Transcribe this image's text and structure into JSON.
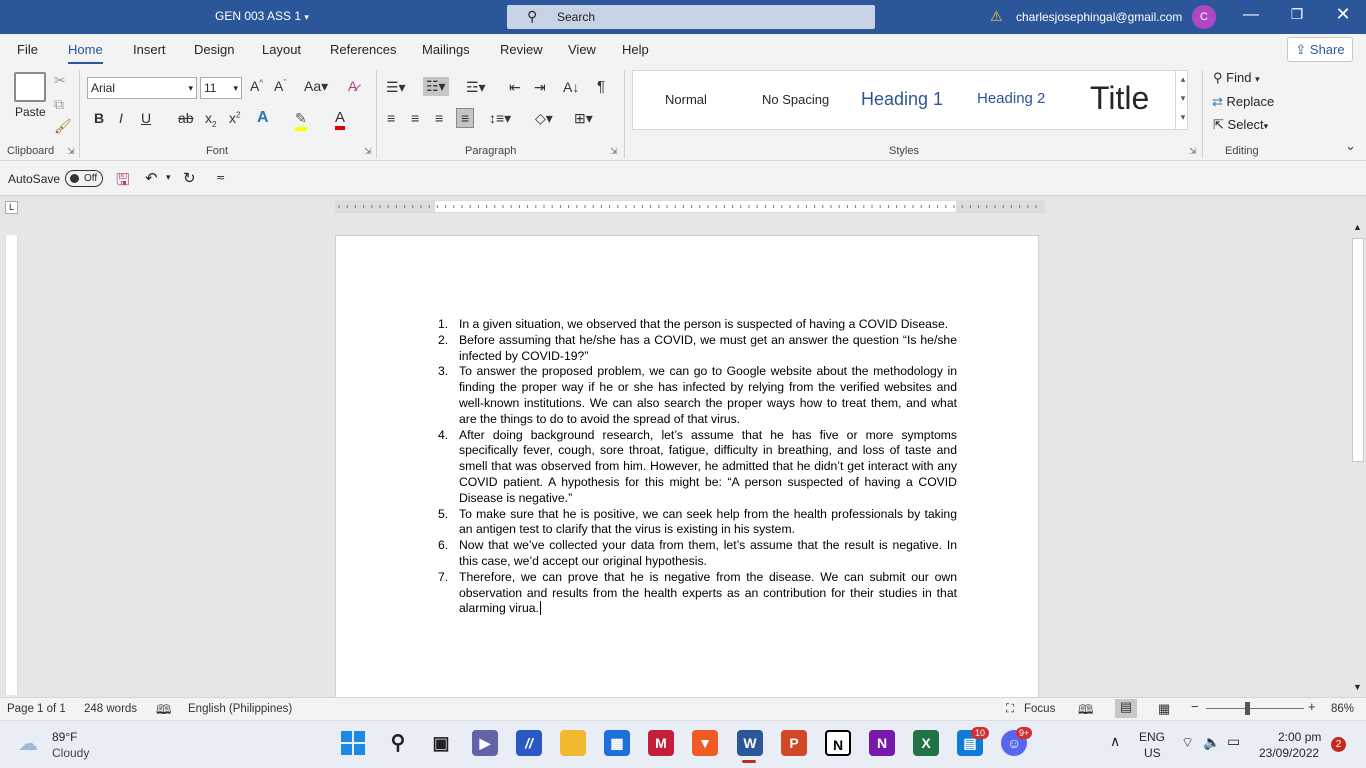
{
  "titlebar": {
    "doc_title": "GEN 003 ASS 1",
    "search_placeholder": "Search",
    "email": "charlesjosephingal@gmail.com",
    "avatar_initial": "C"
  },
  "tabs": [
    "File",
    "Home",
    "Insert",
    "Design",
    "Layout",
    "References",
    "Mailings",
    "Review",
    "View",
    "Help"
  ],
  "share_label": "Share",
  "ribbon": {
    "clipboard": {
      "paste_label": "Paste",
      "group_label": "Clipboard"
    },
    "font": {
      "font_name": "Arial",
      "font_size": "11",
      "group_label": "Font"
    },
    "paragraph": {
      "group_label": "Paragraph"
    },
    "styles": {
      "group_label": "Styles",
      "items": [
        "Normal",
        "No Spacing",
        "Heading 1",
        "Heading 2",
        "Title"
      ]
    },
    "editing": {
      "group_label": "Editing",
      "find": "Find",
      "replace": "Replace",
      "select": "Select"
    }
  },
  "qat": {
    "autosave_label": "AutoSave",
    "autosave_state": "Off"
  },
  "document": {
    "items": [
      "In a given situation, we observed that the person is suspected of having a COVID Disease.",
      "Before assuming that he/she has a COVID, we must get an answer the question “Is he/she infected by COVID-19?”",
      "To answer the proposed problem, we can go to Google website about the methodology in finding the proper way if he or she has infected by relying from the verified websites and well-known institutions. We can also search the proper ways how to treat them, and what are the things to do to avoid the spread of that virus.",
      "After doing background research, let’s assume that he has five or more symptoms specifically fever, cough, sore throat, fatigue, difficulty in breathing, and loss of taste and smell that was observed from him. However, he admitted that he didn’t get interact with any COVID patient. A hypothesis for this might be: “A person suspected of having a COVID Disease is negative.”",
      "To make sure that he is positive, we can seek help from the health professionals by taking an antigen test to clarify that the virus is existing in his system.",
      "Now that we’ve collected your data from them, let’s assume that the result is negative. In this case, we’d accept our original hypothesis.",
      "Therefore, we can prove that he is negative from the disease. We can submit our own observation and results from the health experts as an contribution for their studies in that alarming virua."
    ],
    "numbers": [
      "1.",
      "2.",
      "3.",
      "4.",
      "5.",
      "6.",
      "7."
    ]
  },
  "statusbar": {
    "page": "Page 1 of 1",
    "words": "248 words",
    "language": "English (Philippines)",
    "focus": "Focus",
    "zoom": "86%"
  },
  "taskbar": {
    "weather_temp": "89°F",
    "weather_desc": "Cloudy",
    "lang_line1": "ENG",
    "lang_line2": "US",
    "time": "2:00 pm",
    "date": "23/09/2022",
    "notif_count": "2",
    "onenote_badge": "10",
    "discord_badge": "9+"
  },
  "colors": {
    "word_blue": "#2b579a",
    "ribbon_bg": "#f3f3f3"
  }
}
